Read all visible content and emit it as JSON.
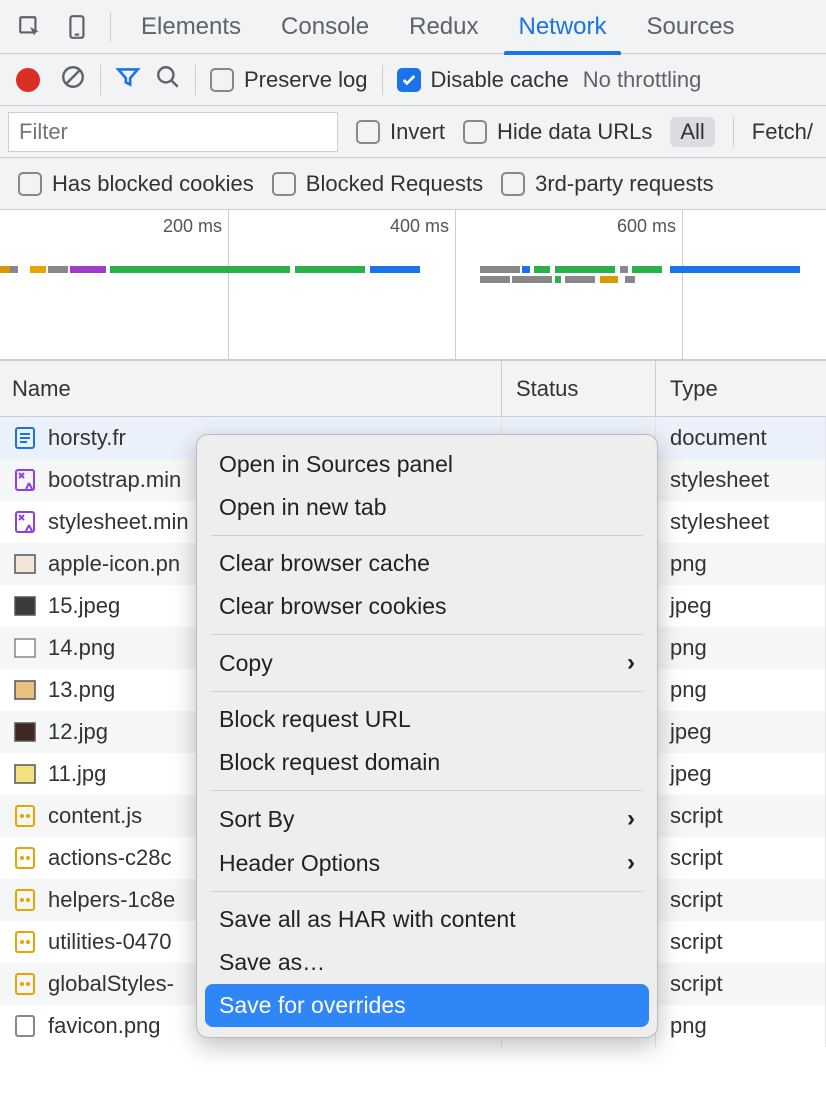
{
  "tabs": {
    "items": [
      "Elements",
      "Console",
      "Redux",
      "Network",
      "Sources"
    ],
    "active_index": 3
  },
  "toolbar": {
    "preserve_log": "Preserve log",
    "disable_cache": "Disable cache",
    "no_throttling": "No throttling"
  },
  "filterrow": {
    "filter_placeholder": "Filter",
    "invert": "Invert",
    "hide_data_urls": "Hide data URLs",
    "all_pill": "All",
    "fetch": "Fetch/"
  },
  "filterrow2": {
    "blocked_cookies": "Has blocked cookies",
    "blocked_requests": "Blocked Requests",
    "third_party": "3rd-party requests"
  },
  "timeline": {
    "ticks": [
      "200 ms",
      "400 ms",
      "600 ms"
    ]
  },
  "table": {
    "headers": {
      "name": "Name",
      "status": "Status",
      "type": "Type"
    },
    "rows": [
      {
        "name": "horsty.fr",
        "type": "document",
        "icon": "doc",
        "selected": true
      },
      {
        "name": "bootstrap.min",
        "type": "stylesheet",
        "icon": "css"
      },
      {
        "name": "stylesheet.min",
        "type": "stylesheet",
        "icon": "css"
      },
      {
        "name": "apple-icon.pn",
        "type": "png",
        "icon": "image"
      },
      {
        "name": "15.jpeg",
        "type": "jpeg",
        "icon": "image-dark"
      },
      {
        "name": "14.png",
        "type": "png",
        "icon": "image-outline"
      },
      {
        "name": "13.png",
        "type": "png",
        "icon": "image-warm"
      },
      {
        "name": "12.jpg",
        "type": "jpeg",
        "icon": "image-dark2"
      },
      {
        "name": "11.jpg",
        "type": "jpeg",
        "icon": "image-yellow"
      },
      {
        "name": "content.js",
        "type": "script",
        "icon": "js"
      },
      {
        "name": "actions-c28c",
        "type": "script",
        "icon": "js"
      },
      {
        "name": "helpers-1c8e",
        "type": "script",
        "icon": "js"
      },
      {
        "name": "utilities-0470",
        "type": "script",
        "icon": "js"
      },
      {
        "name": "globalStyles-",
        "type": "script",
        "icon": "js"
      },
      {
        "name": "favicon.png",
        "type": "png",
        "icon": "blank"
      }
    ]
  },
  "context_menu": {
    "items": [
      {
        "label": "Open in Sources panel"
      },
      {
        "label": "Open in new tab"
      },
      {
        "sep": true
      },
      {
        "label": "Clear browser cache"
      },
      {
        "label": "Clear browser cookies"
      },
      {
        "sep": true
      },
      {
        "label": "Copy",
        "submenu": true
      },
      {
        "sep": true
      },
      {
        "label": "Block request URL"
      },
      {
        "label": "Block request domain"
      },
      {
        "sep": true
      },
      {
        "label": "Sort By",
        "submenu": true
      },
      {
        "label": "Header Options",
        "submenu": true
      },
      {
        "sep": true
      },
      {
        "label": "Save all as HAR with content"
      },
      {
        "label": "Save as…"
      },
      {
        "label": "Save for overrides",
        "highlight": true
      }
    ]
  }
}
